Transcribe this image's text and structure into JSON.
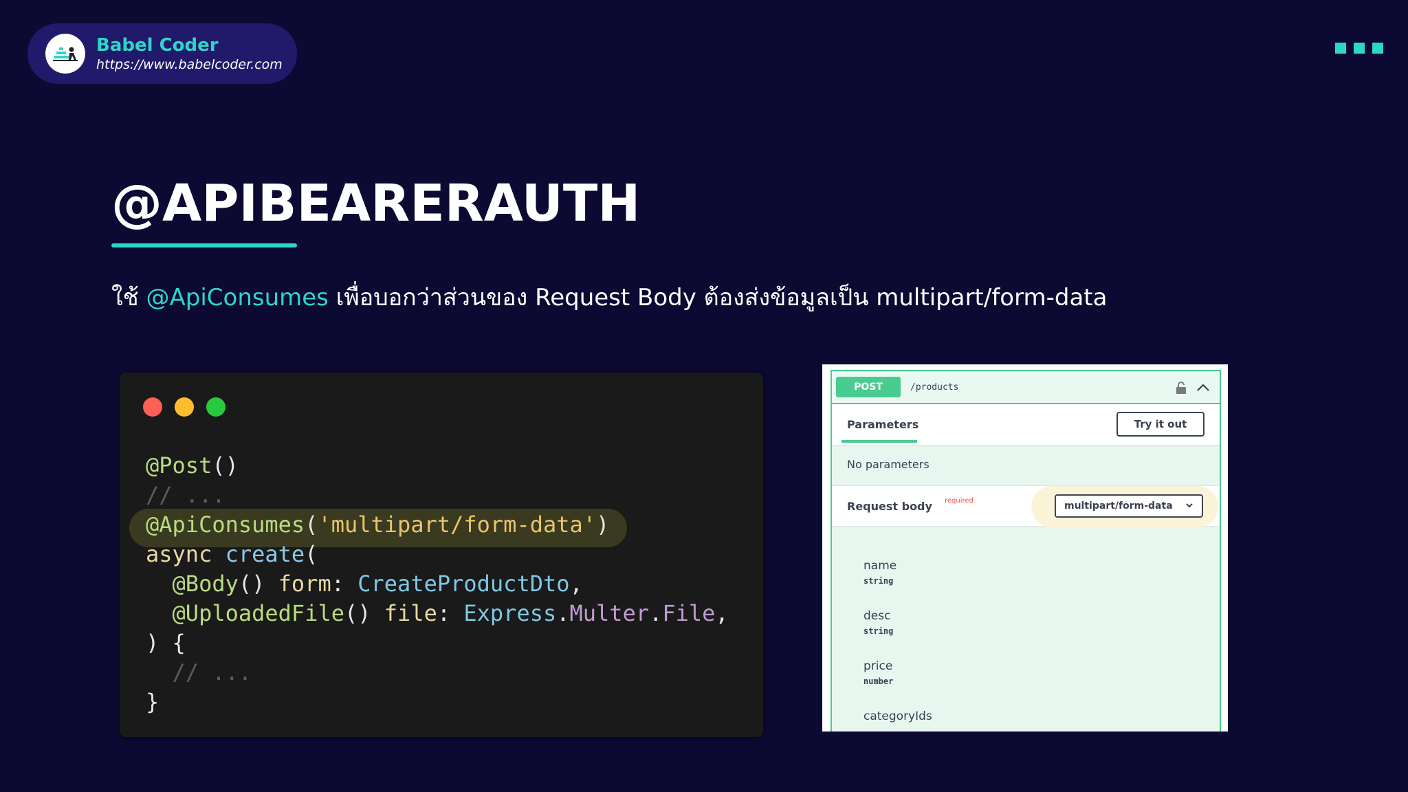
{
  "brand": {
    "name": "Babel Coder",
    "url": "https://www.babelcoder.com"
  },
  "slide": {
    "title": "@APIBEARERAUTH",
    "subtitle_prefix": "ใช้ ",
    "subtitle_accent": "@ApiConsumes",
    "subtitle_suffix": " เพื่อบอกว่าส่วนของ Request Body ต้องส่งข้อมูลเป็น multipart/form-data"
  },
  "colors": {
    "background": "#0c0a33",
    "accent": "#2ed6c8",
    "post_green": "#49cc90",
    "close": "#ff5f56",
    "minimize": "#ffbd2e",
    "maximize": "#27c93f"
  },
  "code": {
    "lines": [
      [
        {
          "t": "@Post",
          "c": "c-dec"
        },
        {
          "t": "()",
          "c": "c-pn"
        }
      ],
      [
        {
          "t": "// ...",
          "c": "c-com"
        }
      ],
      [
        {
          "t": "@ApiConsumes",
          "c": "c-dec"
        },
        {
          "t": "(",
          "c": "c-pn"
        },
        {
          "t": "'multipart/form-data'",
          "c": "c-str"
        },
        {
          "t": ")",
          "c": "c-pn"
        }
      ],
      [
        {
          "t": "async",
          "c": "c-kw"
        },
        {
          "t": " ",
          "c": "c-pn"
        },
        {
          "t": "create",
          "c": "c-fn"
        },
        {
          "t": "(",
          "c": "c-pn"
        }
      ],
      [
        {
          "t": "  ",
          "c": "c-pn"
        },
        {
          "t": "@Body",
          "c": "c-dec"
        },
        {
          "t": "() ",
          "c": "c-pn"
        },
        {
          "t": "form",
          "c": "c-kw"
        },
        {
          "t": ": ",
          "c": "c-pn"
        },
        {
          "t": "CreateProductDto",
          "c": "c-ty"
        },
        {
          "t": ",",
          "c": "c-pn"
        }
      ],
      [
        {
          "t": "  ",
          "c": "c-pn"
        },
        {
          "t": "@UploadedFile",
          "c": "c-dec"
        },
        {
          "t": "() ",
          "c": "c-pn"
        },
        {
          "t": "file",
          "c": "c-kw"
        },
        {
          "t": ": ",
          "c": "c-pn"
        },
        {
          "t": "Express",
          "c": "c-ty"
        },
        {
          "t": ".",
          "c": "c-pn"
        },
        {
          "t": "Multer",
          "c": "c-pr"
        },
        {
          "t": ".",
          "c": "c-pn"
        },
        {
          "t": "File",
          "c": "c-pr"
        },
        {
          "t": ",",
          "c": "c-pn"
        }
      ],
      [
        {
          "t": ") {",
          "c": "c-pn"
        }
      ],
      [
        {
          "t": "  // ...",
          "c": "c-com"
        }
      ],
      [
        {
          "t": "}",
          "c": "c-pn"
        }
      ]
    ]
  },
  "swagger": {
    "method": "POST",
    "path": "/products",
    "tab_parameters": "Parameters",
    "try_button": "Try it out",
    "no_parameters": "No parameters",
    "request_body_label": "Request body",
    "required_label": "required",
    "content_type": "multipart/form-data",
    "fields": [
      {
        "name": "name",
        "type": "string"
      },
      {
        "name": "desc",
        "type": "string"
      },
      {
        "name": "price",
        "type": "number"
      },
      {
        "name": "categoryIds",
        "type": ""
      }
    ]
  }
}
